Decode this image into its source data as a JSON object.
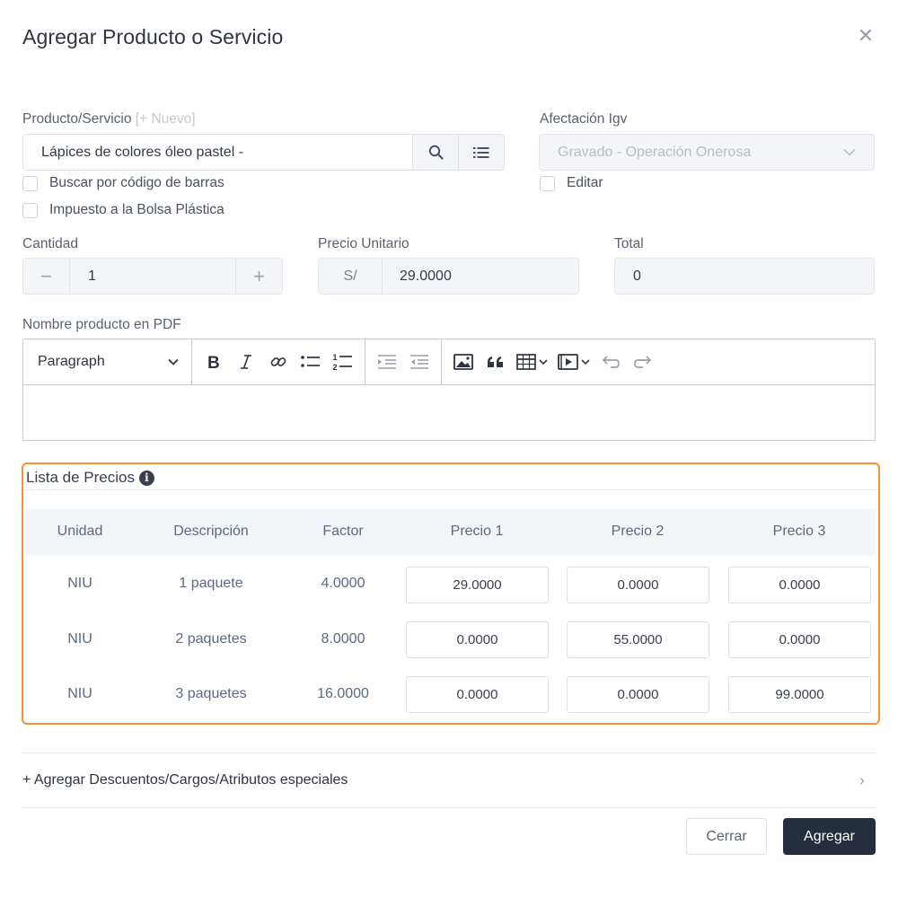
{
  "modal": {
    "title": "Agregar Producto o Servicio",
    "close_icon": "close-icon"
  },
  "product": {
    "label": "Producto/Servicio",
    "new_link": "[+ Nuevo]",
    "value": "Lápices de colores óleo pastel - ",
    "search_icon": "search-icon",
    "list_icon": "list-icon"
  },
  "igv": {
    "label": "Afectación Igv",
    "value": "Gravado - Operación Onerosa",
    "edit_label": "Editar"
  },
  "checkboxes": {
    "barcode": "Buscar por código de barras",
    "bag_tax": "Impuesto a la Bolsa Plástica"
  },
  "quantity": {
    "label": "Cantidad",
    "value": "1",
    "minus": "−",
    "plus": "+"
  },
  "unit_price": {
    "label": "Precio Unitario",
    "prefix": "S/",
    "value": "29.0000"
  },
  "total": {
    "label": "Total",
    "value": "0"
  },
  "pdf_name": {
    "label": "Nombre producto en PDF",
    "format": "Paragraph"
  },
  "price_list": {
    "title": "Lista de Precios",
    "border_color": "#f0962e",
    "headers": [
      "Unidad",
      "Descripción",
      "Factor",
      "Precio 1",
      "Precio 2",
      "Precio 3"
    ],
    "rows": [
      {
        "unit": "NIU",
        "description": "1 paquete",
        "factor": "4.0000",
        "p1": "29.0000",
        "p2": "0.0000",
        "p3": "0.0000"
      },
      {
        "unit": "NIU",
        "description": "2 paquetes",
        "factor": "8.0000",
        "p1": "0.0000",
        "p2": "55.0000",
        "p3": "0.0000"
      },
      {
        "unit": "NIU",
        "description": "3 paquetes",
        "factor": "16.0000",
        "p1": "0.0000",
        "p2": "0.0000",
        "p3": "99.0000"
      }
    ]
  },
  "extras": {
    "label": "+ Agregar Descuentos/Cargos/Atributos especiales"
  },
  "footer": {
    "close_label": "Cerrar",
    "add_label": "Agregar",
    "primary_color": "#252d3e"
  }
}
